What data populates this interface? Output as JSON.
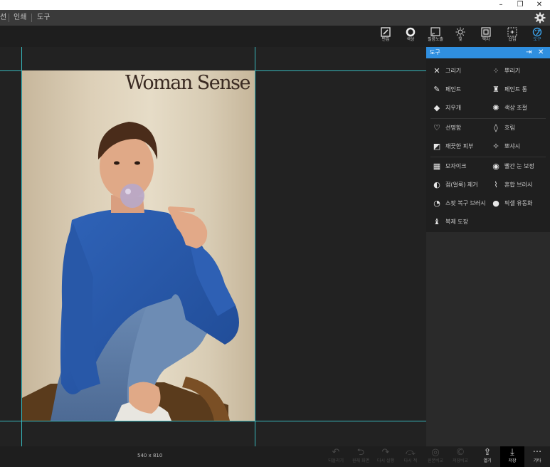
{
  "window": {
    "minimize": "–",
    "restore": "❐",
    "close": "✕"
  },
  "menu": {
    "items": [
      "선",
      "인쇄",
      "도구"
    ],
    "settings_icon": "gear-icon"
  },
  "toolbar": {
    "items": [
      {
        "label": "편집",
        "icon": "edit-icon"
      },
      {
        "label": "색상",
        "icon": "circle-icon"
      },
      {
        "label": "필름노출",
        "icon": "film-icon"
      },
      {
        "label": "빛",
        "icon": "sun-icon"
      },
      {
        "label": "액자",
        "icon": "frame-icon"
      },
      {
        "label": "삽입",
        "icon": "insert-icon"
      },
      {
        "label": "도구",
        "icon": "palette-icon"
      }
    ]
  },
  "canvas": {
    "magazine_title": "Woman Sense"
  },
  "panel": {
    "title": "도구",
    "items": [
      {
        "label": "그리기",
        "icon": "✕"
      },
      {
        "label": "뿌리기",
        "icon": "⁘"
      },
      {
        "label": "페인트",
        "icon": "✎"
      },
      {
        "label": "페인트 통",
        "icon": "♜"
      },
      {
        "label": "지우개",
        "icon": "◆"
      },
      {
        "label": "색상 조절",
        "icon": "✺"
      },
      {
        "label": "선명함",
        "icon": "♡"
      },
      {
        "label": "흐림",
        "icon": "◊"
      },
      {
        "label": "깨끗한 피부",
        "icon": "◩"
      },
      {
        "label": "뽀샤시",
        "icon": "✧"
      },
      {
        "label": "모자이크",
        "icon": "▦"
      },
      {
        "label": "빨간 눈 보정",
        "icon": "◉"
      },
      {
        "label": "점(얼룩) 제거",
        "icon": "◐"
      },
      {
        "label": "혼합 브러시",
        "icon": "⌇"
      },
      {
        "label": "스팟 복구 브러시",
        "icon": "◔"
      },
      {
        "label": "픽셀 유동화",
        "icon": "●"
      },
      {
        "label": "복제 도장",
        "icon": "♝"
      }
    ]
  },
  "status": {
    "dimensions": "540 x 810"
  },
  "bottom": {
    "buttons": [
      {
        "label": "되돌리기",
        "icon": "↶"
      },
      {
        "label": "원래 화면",
        "icon": "⮌"
      },
      {
        "label": "다시 실행",
        "icon": "↷"
      },
      {
        "label": "다시 적",
        "icon": "⤼"
      },
      {
        "label": "원본비교",
        "icon": "◎"
      },
      {
        "label": "저장비교",
        "icon": "©"
      },
      {
        "label": "열기",
        "icon": "⇪"
      },
      {
        "label": "저장",
        "icon": "⤓"
      },
      {
        "label": "기타",
        "icon": "···"
      }
    ]
  }
}
